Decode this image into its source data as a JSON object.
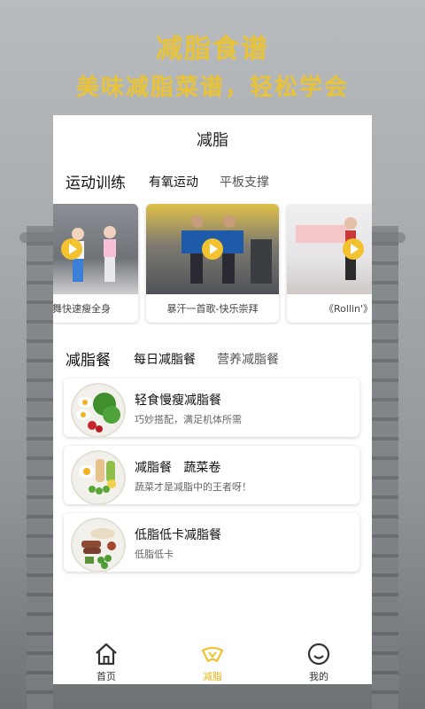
{
  "promo": {
    "title": "减脂食谱",
    "subtitle": "美味减脂菜谱，轻松学会"
  },
  "header": {
    "title": "减脂"
  },
  "training": {
    "section_title": "运动训练",
    "tabs": [
      {
        "label": "有氧运动",
        "active": true
      },
      {
        "label": "平板支撑",
        "active": false
      }
    ],
    "videos": [
      {
        "caption": "一支舞快速瘦全身"
      },
      {
        "caption": "暴汗一首歌-快乐崇拜"
      },
      {
        "caption": "《Rollin'》高"
      }
    ]
  },
  "meals": {
    "section_title": "减脂餐",
    "tabs": [
      {
        "label": "每日减脂餐",
        "active": true
      },
      {
        "label": "营养减脂餐",
        "active": false
      }
    ],
    "items": [
      {
        "name": "轻食慢瘦减脂餐",
        "desc": "巧妙搭配，满足机体所需"
      },
      {
        "name": "减脂餐   蔬菜卷",
        "desc": "蔬菜才是减脂中的王者呀！"
      },
      {
        "name": "低脂低卡减脂餐",
        "desc": "低脂低卡"
      }
    ]
  },
  "bottom_nav": {
    "items": [
      {
        "label": "首页",
        "icon": "home-icon",
        "active": false
      },
      {
        "label": "减脂",
        "icon": "fat-loss-icon",
        "active": true
      },
      {
        "label": "我的",
        "icon": "smile-icon",
        "active": false
      }
    ]
  },
  "colors": {
    "accent": "#f2c230",
    "promo_text": "#e8c33a"
  }
}
